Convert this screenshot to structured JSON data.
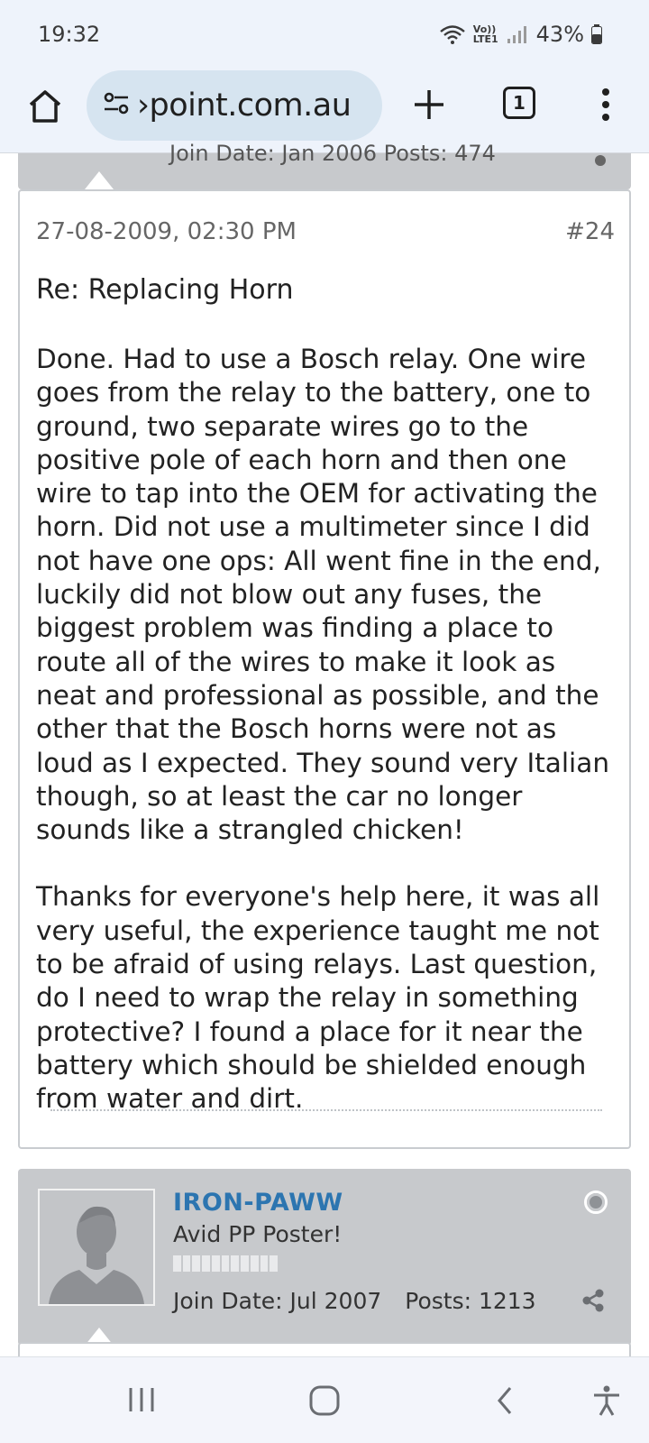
{
  "status_bar": {
    "time": "19:32",
    "battery": "43%",
    "icons": [
      "wifi-icon",
      "volte-icon",
      "signal-icon",
      "battery-icon"
    ],
    "volte_text": "Vo))",
    "lte_text": "LTE1"
  },
  "browser": {
    "url": "›point.com.au",
    "tab_count": "1",
    "icons": [
      "home-icon",
      "site-settings-icon",
      "new-tab-icon",
      "tab-switcher-icon",
      "overflow-menu-icon"
    ]
  },
  "prev_post": {
    "cut_text": "Join Date: Jan 2006   Posts: 474"
  },
  "post": {
    "date": "27-08-2009, 02:30 PM",
    "number": "#24",
    "title": "Re: Replacing Horn",
    "paragraphs": [
      "Done. Had to use a Bosch relay. One wire goes from the relay to the battery, one to ground, two separate wires go to the positive pole of each horn and then one wire to tap into the OEM for activating the horn. Did not use a multimeter since I did not have one ops: All went fine in the end, luckily did not blow out any fuses, the biggest problem was finding a place to route all of the wires to make it look as neat and professional as possible, and the other that the Bosch horns were not as loud as I expected. They sound very Italian though, so at least the car no longer sounds like a strangled chicken!",
      "Thanks for everyone's help here, it was all very useful, the experience taught me not to be afraid of using relays. Last question, do I need to wrap the relay in something protective? I found a place for it near the battery which should be shielded enough from water and dirt."
    ]
  },
  "next_user": {
    "username": "IRON-PAWW",
    "rank": "Avid PP Poster!",
    "join_date": "Join Date: Jul 2007",
    "posts": "Posts: 1213",
    "status": "offline"
  },
  "nav_bar": {
    "items": [
      "recent-apps-icon",
      "home-icon",
      "back-icon",
      "accessibility-icon"
    ]
  },
  "colors": {
    "username": "#2c75b0",
    "header_bg": "#c7c9cc",
    "browser_bg": "#eef3fb",
    "url_pill": "#d6e4f0"
  }
}
